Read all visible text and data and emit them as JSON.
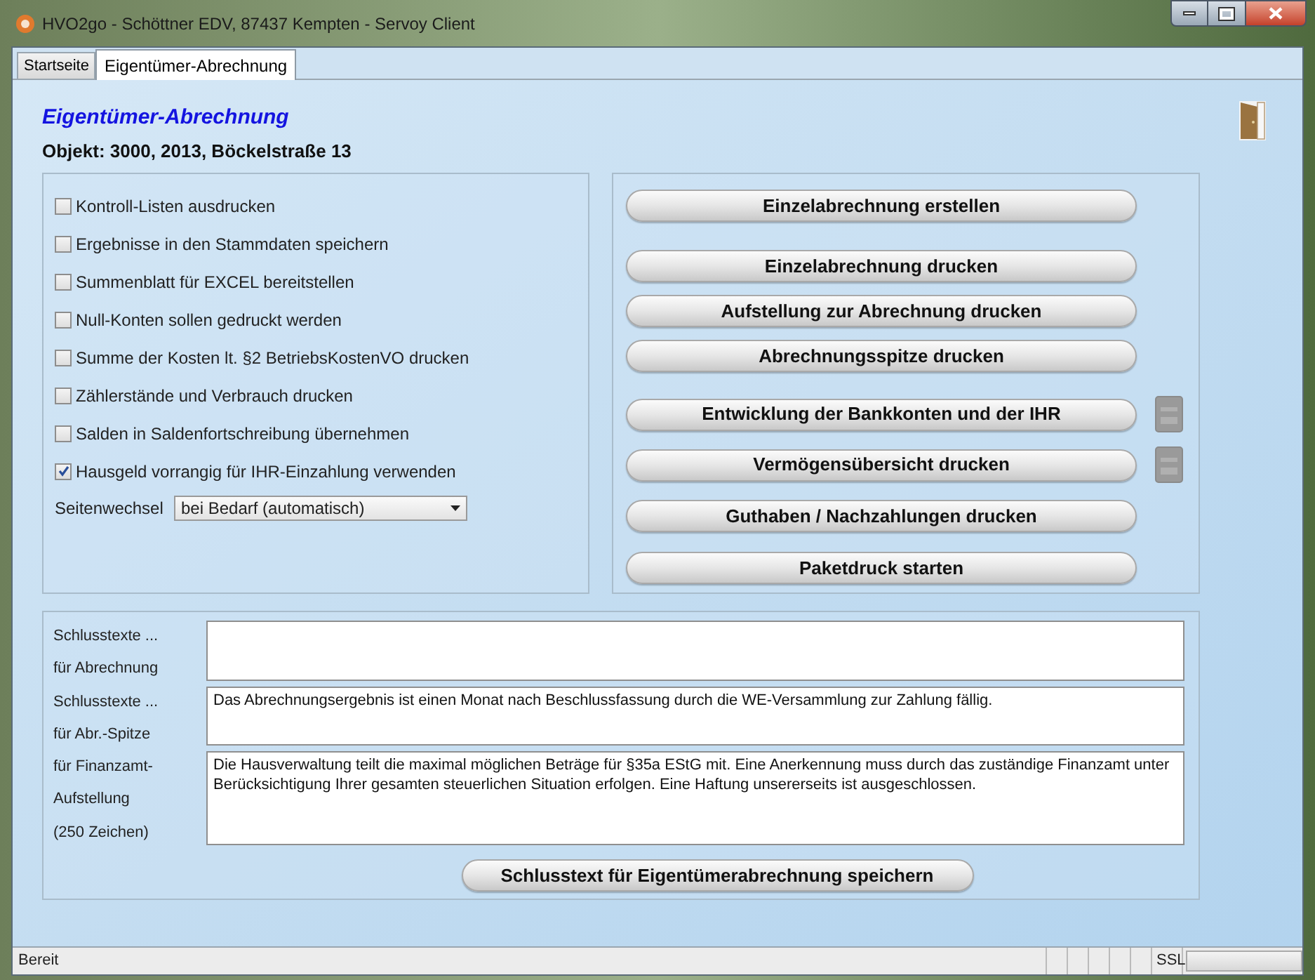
{
  "window": {
    "title": "HVO2go - Schöttner EDV, 87437 Kempten  - Servoy Client"
  },
  "tabs": [
    {
      "label": "Startseite",
      "selected": false
    },
    {
      "label": "Eigentümer-Abrechnung",
      "selected": true
    }
  ],
  "header": {
    "title": "Eigentümer-Abrechnung",
    "subtitle": "Objekt: 3000, 2013, Böckelstraße 13"
  },
  "options": [
    {
      "label": "Kontroll-Listen ausdrucken",
      "checked": false
    },
    {
      "label": "Ergebnisse in den Stammdaten speichern",
      "checked": false
    },
    {
      "label": "Summenblatt für EXCEL bereitstellen",
      "checked": false
    },
    {
      "label": "Null-Konten sollen gedruckt werden",
      "checked": false
    },
    {
      "label": "Summe der Kosten lt. §2 BetriebsKostenVO drucken",
      "checked": false
    },
    {
      "label": "Zählerstände und Verbrauch drucken",
      "checked": false
    },
    {
      "label": "Salden in Saldenfortschreibung übernehmen",
      "checked": false
    },
    {
      "label": "Hausgeld vorrangig für IHR-Einzahlung verwenden",
      "checked": true
    }
  ],
  "page_break": {
    "label": "Seitenwechsel",
    "value": "bei Bedarf (automatisch)"
  },
  "actions": [
    {
      "label": "Einzelabrechnung erstellen",
      "side_icon": false
    },
    {
      "label": "Einzelabrechnung drucken",
      "side_icon": false
    },
    {
      "label": "Aufstellung zur Abrechnung drucken",
      "side_icon": false
    },
    {
      "label": "Abrechnungsspitze drucken",
      "side_icon": false
    },
    {
      "label": "Entwicklung der Bankkonten und der IHR",
      "side_icon": true
    },
    {
      "label": "Vermögensübersicht drucken",
      "side_icon": true
    },
    {
      "label": "Guthaben / Nachzahlungen drucken",
      "side_icon": false
    },
    {
      "label": "Paketdruck starten",
      "side_icon": false
    }
  ],
  "closing_texts": {
    "labels": [
      "Schlusstexte ...",
      "für Abrechnung",
      "Schlusstexte ...",
      "für Abr.-Spitze",
      "für Finanzamt-",
      "Aufstellung",
      "(250 Zeichen)"
    ],
    "fields": [
      {
        "kind": "empty"
      },
      {
        "kind": "text",
        "value": "Das Abrechnungsergebnis ist einen Monat nach Beschlussfassung durch die WE-Versammlung zur Zahlung fällig."
      },
      {
        "kind": "text",
        "value": "Die Hausverwaltung teilt die maximal möglichen Beträge für §35a EStG mit. Eine Anerkennung muss durch das zuständige Finanzamt unter Berücksichtigung Ihrer gesamten steuerlichen Situation erfolgen. Eine Haftung unsererseits ist ausgeschlossen."
      }
    ],
    "save_button": "Schlusstext für Eigentümerabrechnung speichern"
  },
  "status_bar": {
    "text": "Bereit",
    "ssl": "SSL"
  }
}
